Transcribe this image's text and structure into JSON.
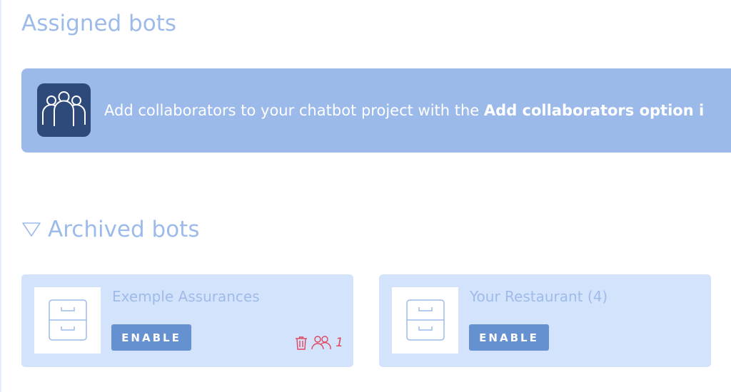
{
  "assigned": {
    "title": "Assigned bots"
  },
  "banner": {
    "icon": "collaborators-icon",
    "text_prefix": "Add collaborators to your chatbot project with the ",
    "text_bold": "Add collaborators option i"
  },
  "archived": {
    "title": "Archived bots",
    "toggle_icon": "triangle-down-icon",
    "bots": [
      {
        "name": "Exemple Assurances",
        "enable_label": "ENABLE",
        "thumb_icon": "archive-drawer-icon",
        "delete_icon": "trash-icon",
        "collaborators_icon": "people-icon",
        "collaborator_count": "1"
      },
      {
        "name": "Your Restaurant (4)",
        "enable_label": "ENABLE",
        "thumb_icon": "archive-drawer-icon"
      }
    ]
  },
  "colors": {
    "heading": "#9dbbea",
    "banner_bg": "#9bbae9",
    "banner_icon_bg": "#2d4a7a",
    "card_bg": "#d3e3fb",
    "button_bg": "#6691d0",
    "danger": "#e0455f"
  }
}
